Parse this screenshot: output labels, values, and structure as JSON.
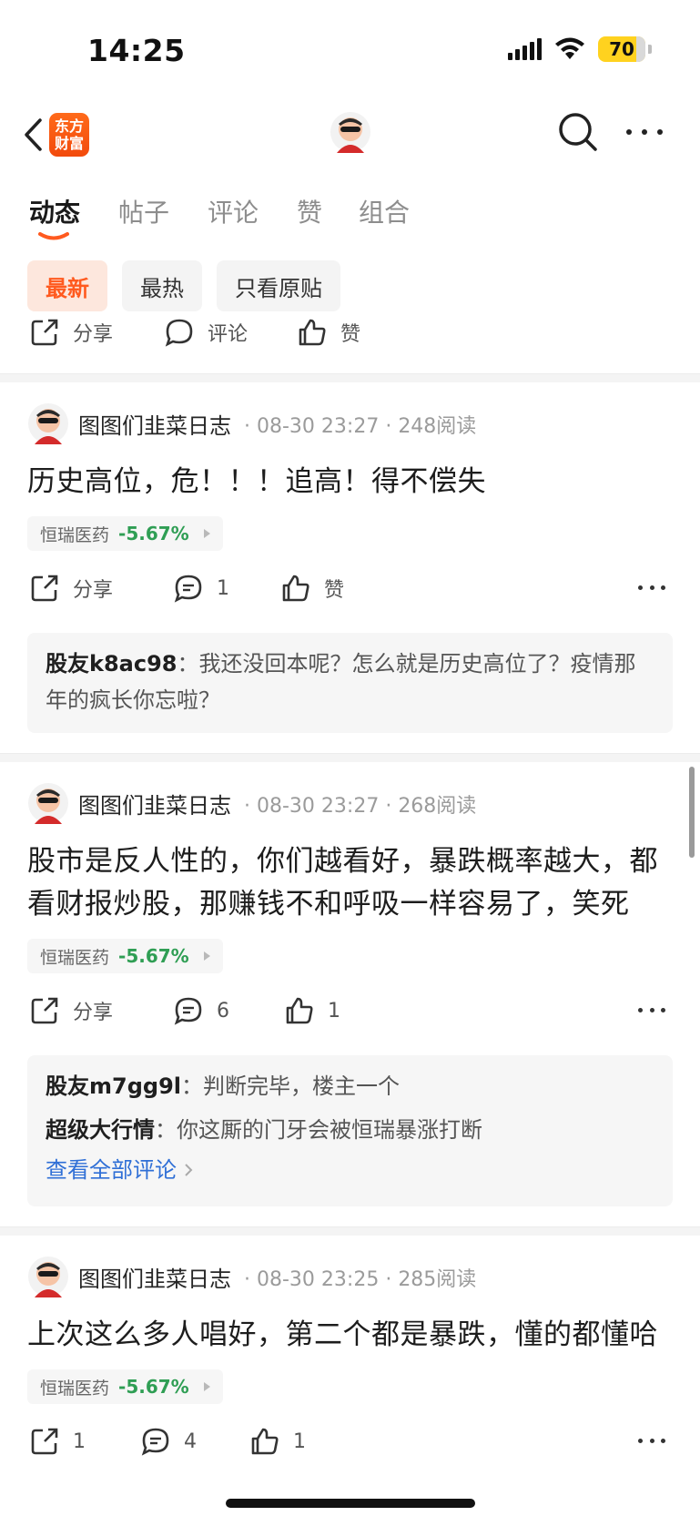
{
  "status_bar": {
    "time": "14:25",
    "battery": "70"
  },
  "nav": {
    "brand_logo": "东方财富",
    "icons": [
      "back-icon",
      "search-icon",
      "more-icon"
    ]
  },
  "tabs": [
    {
      "label": "动态",
      "active": true
    },
    {
      "label": "帖子"
    },
    {
      "label": "评论"
    },
    {
      "label": "赞"
    },
    {
      "label": "组合"
    }
  ],
  "filters": [
    {
      "label": "最新",
      "active": true
    },
    {
      "label": "最热"
    },
    {
      "label": "只看原贴"
    }
  ],
  "top_partial_actions": {
    "share_label": "分享",
    "comment_label": "评论",
    "like_label": "赞"
  },
  "posts": [
    {
      "author": "图图们韭菜日志",
      "time": "08-30 23:27",
      "reads": "248阅读",
      "content": "历史高位，危！！！追高！得不偿失",
      "stock_name": "恒瑞医药",
      "stock_change": "-5.67%",
      "share_label": "分享",
      "comment_count": "1",
      "like_label": "赞",
      "comments": [
        {
          "user": "股友k8ac98",
          "sep": "：",
          "text": "我还没回本呢？怎么就是历史高位了？疫情那年的疯长你忘啦？"
        }
      ]
    },
    {
      "author": "图图们韭菜日志",
      "time": "08-30 23:27",
      "reads": "268阅读",
      "content": "股市是反人性的，你们越看好，暴跌概率越大，都看财报炒股，那赚钱不和呼吸一样容易了，笑死",
      "stock_name": "恒瑞医药",
      "stock_change": "-5.67%",
      "share_label": "分享",
      "comment_count": "6",
      "like_label": "1",
      "comments": [
        {
          "user": "股友m7gg9l",
          "sep": "：",
          "text": "判断完毕，楼主一个"
        },
        {
          "user": "超级大行情",
          "sep": "：",
          "text": "你这厮的门牙会被恒瑞暴涨打断"
        }
      ],
      "view_all": "查看全部评论"
    },
    {
      "author": "图图们韭菜日志",
      "time": "08-30 23:25",
      "reads": "285阅读",
      "content": "上次这么多人唱好，第二个都是暴跌，懂的都懂哈",
      "stock_name": "恒瑞医药",
      "stock_change": "-5.67%",
      "share_label": "1",
      "comment_count": "4",
      "like_label": "1"
    }
  ],
  "colors": {
    "accent": "#ff5a1f",
    "stock_green": "#2f9e54",
    "link_blue": "#2f6fd6"
  }
}
